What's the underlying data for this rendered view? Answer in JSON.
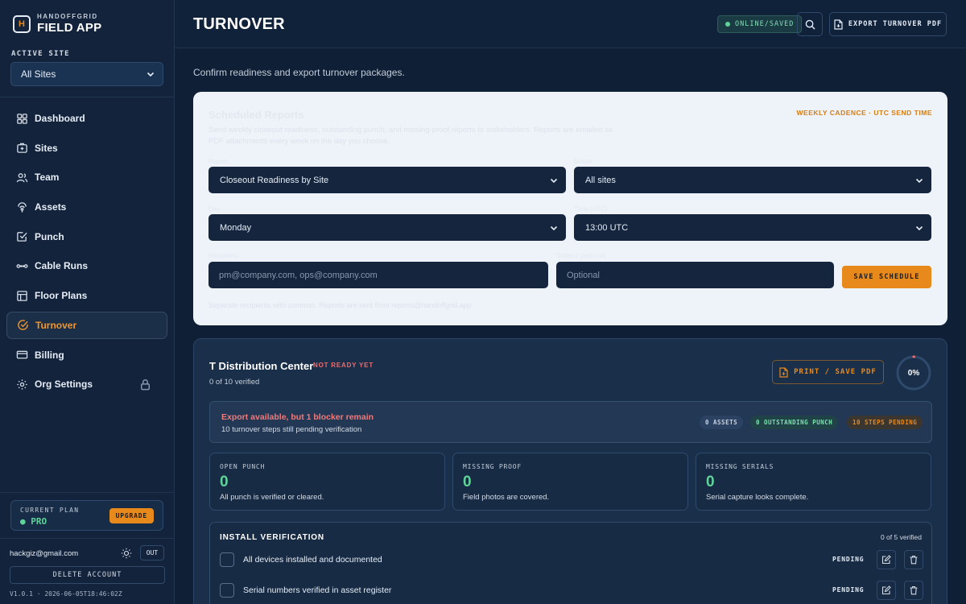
{
  "brand": {
    "subtitle": "HANDOFFGRID",
    "name": "FIELD APP",
    "logo_letter": "H"
  },
  "site_selector": {
    "label": "ACTIVE SITE",
    "value": "All Sites"
  },
  "nav": {
    "items": [
      {
        "label": "Dashboard",
        "icon": "dashboard-icon"
      },
      {
        "label": "Sites",
        "icon": "sites-icon"
      },
      {
        "label": "Team",
        "icon": "team-icon"
      },
      {
        "label": "Assets",
        "icon": "assets-icon"
      },
      {
        "label": "Punch",
        "icon": "punch-icon"
      },
      {
        "label": "Cable Runs",
        "icon": "cable-icon"
      },
      {
        "label": "Floor Plans",
        "icon": "floorplan-icon"
      },
      {
        "label": "Turnover",
        "icon": "turnover-icon",
        "active": true
      },
      {
        "label": "Billing",
        "icon": "billing-icon"
      },
      {
        "label": "Org Settings",
        "icon": "gear-icon",
        "locked": true
      }
    ]
  },
  "plan": {
    "label": "CURRENT PLAN",
    "value": "PRO",
    "upgrade_label": "UPGRADE"
  },
  "account": {
    "email": "hackgiz@gmail.com",
    "out_label": "OUT",
    "delete_label": "DELETE ACCOUNT",
    "version": "V1.0.1 · 2026-06-05T18:46:02Z"
  },
  "header": {
    "title": "TURNOVER",
    "status": "ONLINE/SAVED",
    "export_label": "EXPORT TURNOVER PDF"
  },
  "subtitle": "Confirm readiness and export turnover packages.",
  "schedule": {
    "title": "Scheduled Reports",
    "description": "Send weekly closeout readiness, outstanding punch, and missing-proof reports to stakeholders. Reports are emailed as PDF attachments every week on the day you choose.",
    "cadence": "WEEKLY CADENCE · UTC SEND TIME",
    "report_label": "Report",
    "scope_label": "Scope",
    "day_label": "Day",
    "time_label": "Time (UTC)",
    "report_value": "Closeout Readiness by Site",
    "scope_value": "All sites",
    "day_value": "Monday",
    "time_value": "13:00 UTC",
    "recipients_label": "Recipients",
    "recipients_placeholder": "pm@company.com, ops@company.com",
    "subject_label": "Subject (optional)",
    "subject_placeholder": "Optional",
    "save_label": "SAVE SCHEDULE",
    "footnote": "Separate recipients with commas. Reports are sent from reports@handoffgrid.app"
  },
  "site": {
    "name": "T Distribution Center",
    "status": "NOT READY YET",
    "verified": "0 of 10 verified",
    "print_label": "PRINT / SAVE PDF",
    "progress_text": "0%",
    "progress": 0,
    "blocker_title": "Export available, but 1 blocker remain",
    "blocker_desc": "10 turnover steps still pending verification",
    "chips": {
      "assets": "0 ASSETS",
      "punch": "0 OUTSTANDING PUNCH",
      "steps": "10 STEPS PENDING"
    },
    "metrics": [
      {
        "label": "OPEN PUNCH",
        "value": "0",
        "desc": "All punch is verified or cleared."
      },
      {
        "label": "MISSING PROOF",
        "value": "0",
        "desc": "Field photos are covered."
      },
      {
        "label": "MISSING SERIALS",
        "value": "0",
        "desc": "Serial capture looks complete."
      }
    ],
    "install": {
      "title": "INSTALL VERIFICATION",
      "count": "0 of 5 verified",
      "steps": [
        {
          "label": "All devices installed and documented",
          "status": "PENDING"
        },
        {
          "label": "Serial numbers verified in asset register",
          "status": "PENDING"
        }
      ]
    }
  },
  "colors": {
    "accent": "#e8891c",
    "success": "#5fd39a",
    "danger": "#ef6b6b",
    "background": "#0f1f35"
  }
}
